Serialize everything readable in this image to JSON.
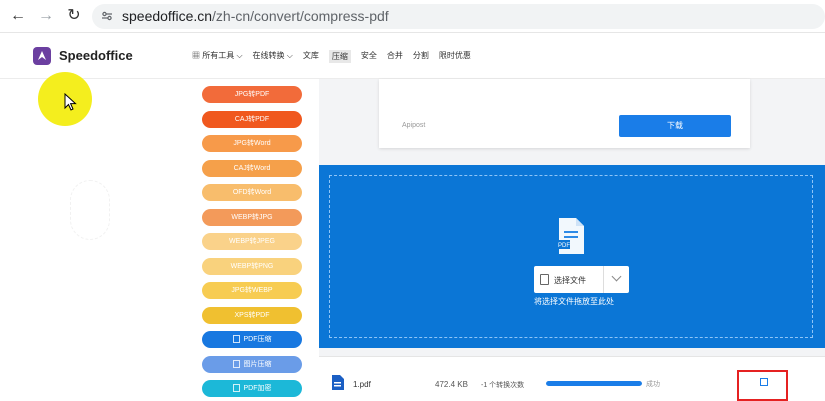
{
  "browser": {
    "url_host": "speedoffice.cn",
    "url_path": "/zh-cn/convert/compress-pdf"
  },
  "header": {
    "logo_text": "Speedoffice",
    "nav": [
      {
        "label": "所有工具"
      },
      {
        "label": "在线转换"
      },
      {
        "label": "文库"
      },
      {
        "label": "压缩"
      },
      {
        "label": "安全"
      },
      {
        "label": "合并"
      },
      {
        "label": "分割"
      },
      {
        "label": "限时优惠"
      }
    ]
  },
  "sidebar": {
    "items": [
      {
        "label": "JPG转PDF",
        "color": "#f26b3a"
      },
      {
        "label": "CAJ转PDF",
        "color": "#f0581e"
      },
      {
        "label": "JPG转Word",
        "color": "#f79a4a"
      },
      {
        "label": "CAJ转Word",
        "color": "#f5a04a"
      },
      {
        "label": "OFD转Word",
        "color": "#f8bd6c"
      },
      {
        "label": "WEBP转JPG",
        "color": "#f39a5a"
      },
      {
        "label": "WEBP转JPEG",
        "color": "#fad28a"
      },
      {
        "label": "WEBP转PNG",
        "color": "#f9d27d"
      },
      {
        "label": "JPG转WEBP",
        "color": "#f7cc52"
      },
      {
        "label": "XPS转PDF",
        "color": "#f0c030"
      },
      {
        "label": "PDF压缩",
        "color": "#1878e0"
      },
      {
        "label": "图片压缩",
        "color": "#6a9ce8"
      },
      {
        "label": "PDF加密",
        "color": "#1cb8d8"
      }
    ]
  },
  "download_card": {
    "caption": "Apipost",
    "button_label": "下载"
  },
  "upload": {
    "doc_tag": "PDF",
    "choose_label": "选择文件",
    "hint": "将选择文件拖放至此处"
  },
  "file": {
    "name": "1.pdf",
    "size": "472.4 KB",
    "count_text": "-1 个转换次数",
    "progress_pct": 100,
    "status": "成功"
  }
}
